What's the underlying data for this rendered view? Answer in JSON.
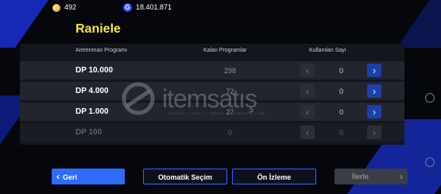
{
  "currency": {
    "coins": "492",
    "gp": "18.401.871",
    "gp_icon_letter": "G"
  },
  "title": "Raniele",
  "columns": {
    "program": "Antrenman Programı",
    "remaining": "Kalan Programlar",
    "used": "Kullanılan Sayı"
  },
  "rows": [
    {
      "dp": "DP 10.000",
      "remaining": "298",
      "used": "0"
    },
    {
      "dp": "DP 4.000",
      "remaining": "72",
      "used": "0"
    },
    {
      "dp": "DP 1.000",
      "remaining": "27",
      "used": "0"
    },
    {
      "dp": "DP 100",
      "remaining": "0",
      "used": "0"
    }
  ],
  "buttons": {
    "back": "Geri",
    "auto_select": "Otomatik Seçim",
    "preview": "Ön İzleme",
    "next": "İlerle"
  },
  "watermark": {
    "text": "itemsatış",
    "sub": "GÜVENLİ  •  HIZLI  •  KOLAY  •  ITEMSATIS.COM"
  },
  "colors": {
    "title": "#f7e43a",
    "accent": "#2f6bff",
    "arrow": "#6fd0ff"
  }
}
